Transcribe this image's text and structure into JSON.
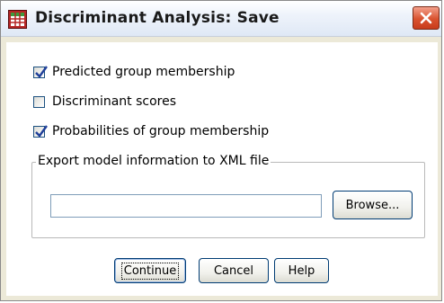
{
  "window": {
    "title": "Discriminant Analysis: Save",
    "app_icon": "grid-table-icon",
    "close_icon": "close-icon"
  },
  "options": [
    {
      "label": "Predicted group membership",
      "checked": true
    },
    {
      "label": "Discriminant scores",
      "checked": false
    },
    {
      "label": "Probabilities of group membership",
      "checked": true
    }
  ],
  "export": {
    "legend": "Export model information to XML file",
    "path_value": "",
    "browse_label": "Browse..."
  },
  "buttons": {
    "continue_label": "Continue",
    "cancel_label": "Cancel",
    "help_label": "Help"
  },
  "colors": {
    "check": "#1f3f99",
    "close_red": "#d9522f",
    "accent_border": "#003c74"
  }
}
